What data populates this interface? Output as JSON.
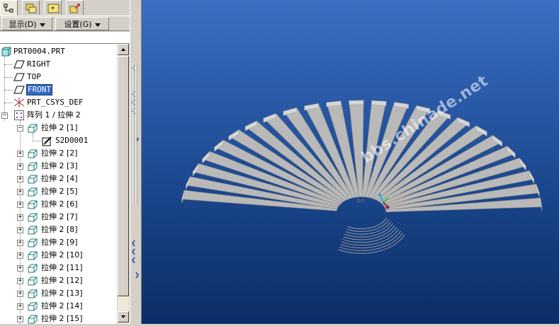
{
  "toolbar": {
    "show_label": "显示(D)",
    "settings_label": "设置(G)"
  },
  "tabs": [
    {
      "icon": "model-tree-icon"
    },
    {
      "icon": "folder-browser-icon"
    },
    {
      "icon": "favorites-icon"
    },
    {
      "icon": "connections-icon"
    }
  ],
  "tree": {
    "root": "PRT0004.PRT",
    "items": [
      {
        "label": "RIGHT",
        "icon": "datum-plane-icon"
      },
      {
        "label": "TOP",
        "icon": "datum-plane-icon"
      },
      {
        "label": "FRONT",
        "icon": "datum-plane-icon",
        "selected": true
      },
      {
        "label": "PRT_CSYS_DEF",
        "icon": "coordinate-system-icon"
      },
      {
        "label": "阵列 1 / 拉伸 2",
        "icon": "pattern-icon",
        "expanded": true
      },
      {
        "label": "拉伸 2 [1]",
        "icon": "extrude-icon",
        "expanded": true
      },
      {
        "label": "S2D0001",
        "icon": "sketch-icon"
      },
      {
        "label": "拉伸 2 [2]",
        "icon": "extrude-icon"
      },
      {
        "label": "拉伸 2 [3]",
        "icon": "extrude-icon"
      },
      {
        "label": "拉伸 2 [4]",
        "icon": "extrude-icon"
      },
      {
        "label": "拉伸 2 [5]",
        "icon": "extrude-icon"
      },
      {
        "label": "拉伸 2 [6]",
        "icon": "extrude-icon"
      },
      {
        "label": "拉伸 2 [7]",
        "icon": "extrude-icon"
      },
      {
        "label": "拉伸 2 [8]",
        "icon": "extrude-icon"
      },
      {
        "label": "拉伸 2 [9]",
        "icon": "extrude-icon"
      },
      {
        "label": "拉伸 2 [10]",
        "icon": "extrude-icon"
      },
      {
        "label": "拉伸 2 [11]",
        "icon": "extrude-icon"
      },
      {
        "label": "拉伸 2 [12]",
        "icon": "extrude-icon"
      },
      {
        "label": "拉伸 2 [13]",
        "icon": "extrude-icon"
      },
      {
        "label": "拉伸 2 [14]",
        "icon": "extrude-icon"
      },
      {
        "label": "拉伸 2 [15]",
        "icon": "extrude-icon"
      }
    ]
  },
  "viewport": {
    "watermark": "bbs.chinade.net",
    "bg_top": "#3d6fc2",
    "bg_bottom": "#0b2d66",
    "part_color": "#b9b9b9"
  },
  "colors": {
    "selection": "#316ac5",
    "panel": "#d4d0c8"
  }
}
